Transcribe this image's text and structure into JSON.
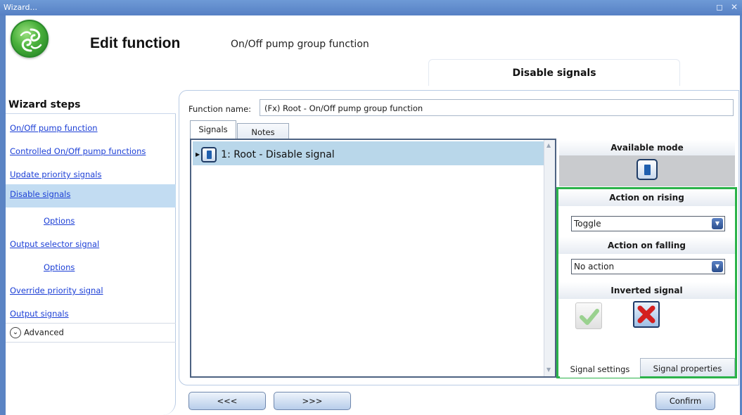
{
  "window": {
    "title": "Wizard..."
  },
  "header": {
    "title": "Edit function",
    "subtitle": "On/Off pump group function",
    "current_step_tab": "Disable signals"
  },
  "sidebar": {
    "heading": "Wizard steps",
    "items": [
      {
        "label": "On/Off pump function"
      },
      {
        "label": "Controlled On/Off pump functions"
      },
      {
        "label": "Update priority signals"
      },
      {
        "label": "Disable signals"
      },
      {
        "label": "Options"
      },
      {
        "label": "Output selector signal"
      },
      {
        "label": "Options"
      },
      {
        "label": "Override priority signal"
      },
      {
        "label": "Output signals"
      }
    ],
    "advanced_label": "Advanced"
  },
  "form": {
    "function_name_label": "Function name:",
    "function_name_value": "(Fx) Root - On/Off pump group function"
  },
  "tabs": [
    {
      "label": "Signals"
    },
    {
      "label": "Notes"
    }
  ],
  "signals_list": [
    {
      "label": "1: Root - Disable signal"
    }
  ],
  "settings": {
    "available_mode_label": "Available mode",
    "action_on_rising_label": "Action on rising",
    "action_on_rising_value": "Toggle",
    "action_on_falling_label": "Action on falling",
    "action_on_falling_value": "No action",
    "inverted_signal_label": "Inverted signal",
    "bottom_tabs": [
      {
        "label": "Signal settings"
      },
      {
        "label": "Signal properties"
      }
    ]
  },
  "footer": {
    "prev_label": "<<<",
    "next_label": ">>>",
    "confirm_label": "Confirm"
  },
  "colors": {
    "accent_green": "#2bb34a",
    "title_bar": "#5b84c4",
    "link": "#1c3fd6"
  },
  "icons": [
    "logo-icon",
    "restore-icon",
    "close-icon",
    "chevron-down-icon",
    "signal-switch-icon",
    "check-icon",
    "cross-icon",
    "dropdown-arrow-icon"
  ]
}
